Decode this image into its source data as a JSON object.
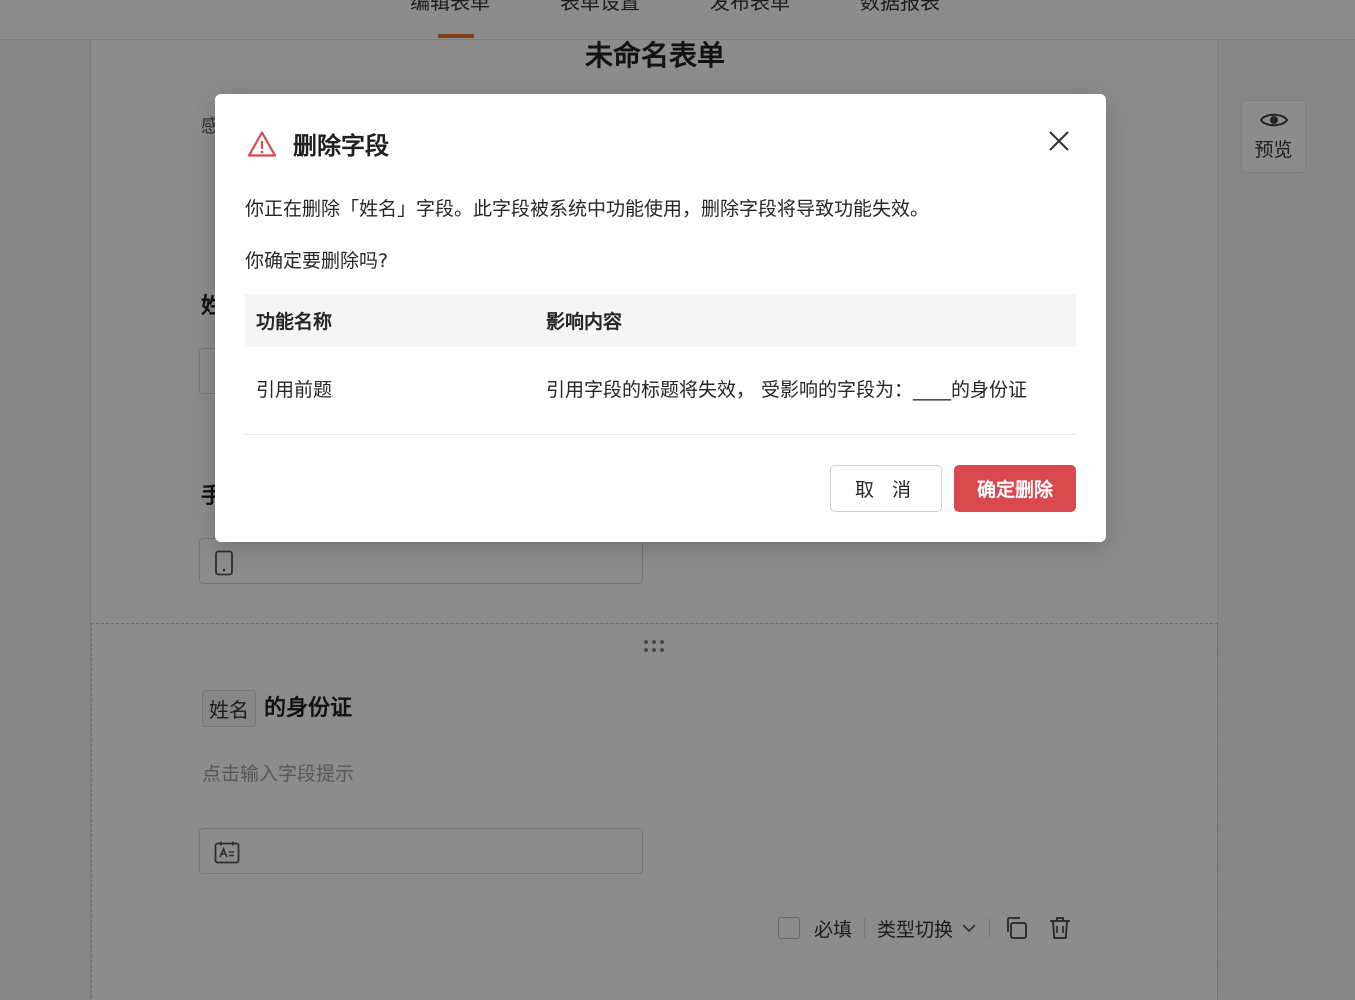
{
  "topbar": {
    "tabs": [
      "编辑表单",
      "表单设置",
      "发布表单",
      "数据报表"
    ]
  },
  "form": {
    "title": "未命名表单",
    "intro_text": "感",
    "field1_label": "姓",
    "field2_label": "手",
    "field3": {
      "ref_tag": "姓名",
      "title": "的身份证",
      "hint": "点击输入字段提示"
    },
    "toolbar": {
      "required_label": "必填",
      "type_switch_label": "类型切换"
    }
  },
  "preview": {
    "label": "预览"
  },
  "dialog": {
    "title": "删除字段",
    "message": "你正在删除「姓名」字段。此字段被系统中功能使用，删除字段将导致功能失效。",
    "confirm_question": "你确定要删除吗?",
    "table": {
      "headers": [
        "功能名称",
        "影响内容"
      ],
      "rows": [
        [
          "引用前题",
          "引用字段的标题将失效， 受影响的字段为：____的身份证"
        ]
      ]
    },
    "cancel_label": "取 消",
    "ok_label": "确定删除"
  },
  "colors": {
    "accent": "#e8792f",
    "danger": "#d9484f"
  },
  "icons": [
    "warning-icon",
    "close-icon",
    "eye-icon",
    "phone-icon",
    "id-card-icon",
    "drag-handle-icon",
    "chevron-down-icon",
    "copy-icon",
    "trash-icon"
  ]
}
